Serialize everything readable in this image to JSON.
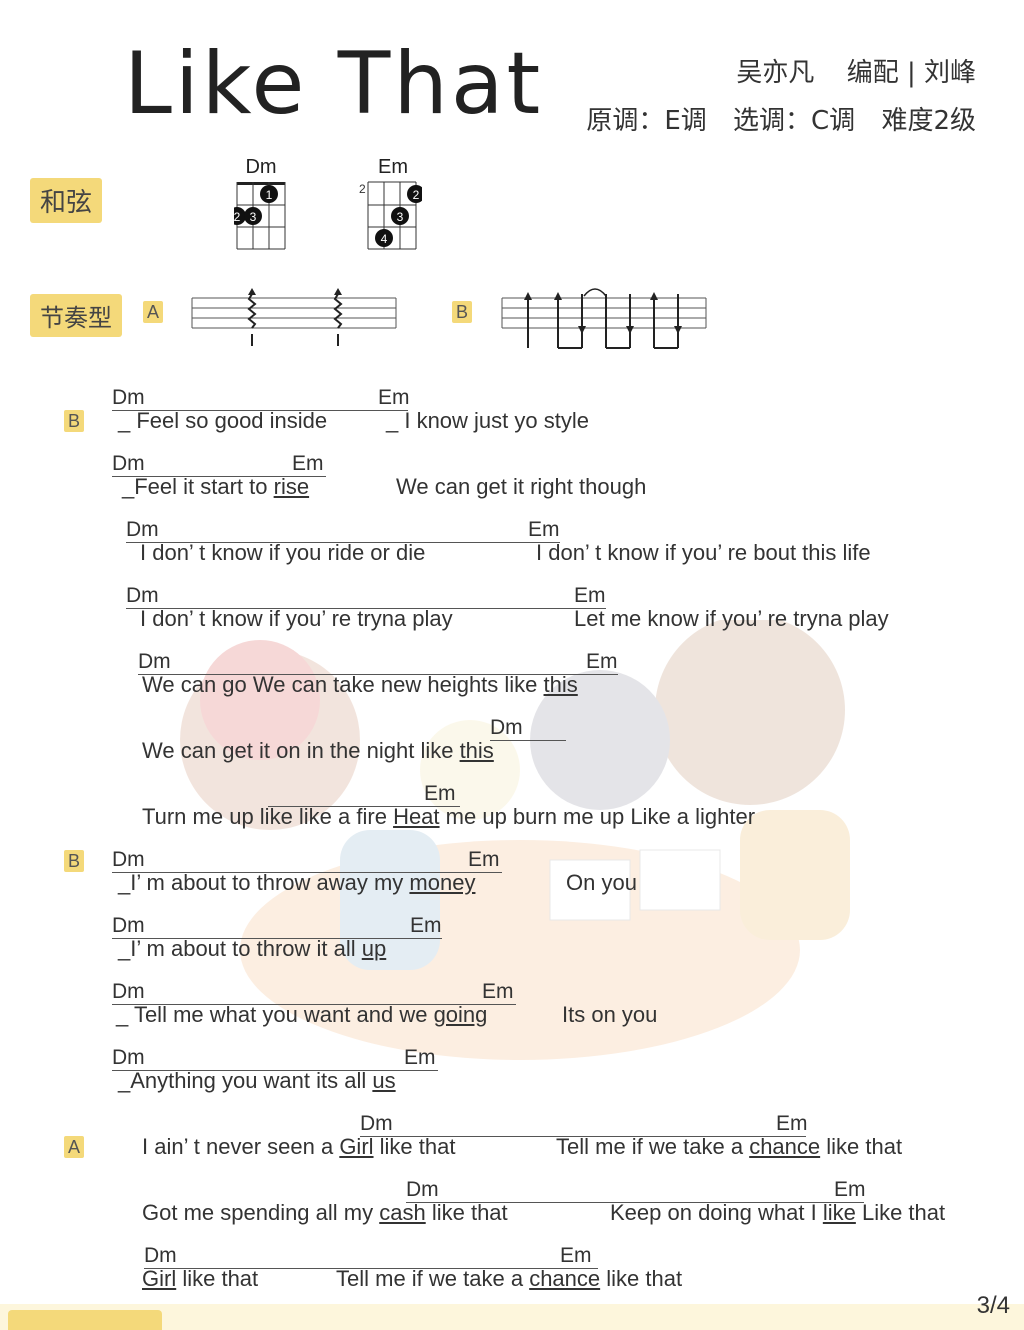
{
  "header": {
    "title": "Like That",
    "artist": "吴亦凡",
    "arranger": "编配 | 刘峰",
    "original_key": "原调：E调",
    "chosen_key": "选调：C调",
    "difficulty": "难度2级"
  },
  "sections": {
    "chords_label": "和弦",
    "rhythm_label": "节奏型",
    "rhythm_a": "A",
    "rhythm_b": "B"
  },
  "chord_diagrams": [
    {
      "name": "Dm",
      "fret_label": "",
      "fingers": [
        "1",
        "2",
        "3"
      ]
    },
    {
      "name": "Em",
      "fret_label": "2",
      "fingers": [
        "2",
        "3",
        "4"
      ]
    }
  ],
  "lyrics": [
    {
      "tag": "B",
      "chords": [
        "Dm",
        "Em"
      ],
      "text_a": "_ Feel so good inside",
      "text_b": "_ I know just yo style"
    },
    {
      "tag": "",
      "chords": [
        "Dm",
        "Em"
      ],
      "text_a": "_Feel it start to ",
      "ul_a": "rise",
      "text_b": "We can get it right though"
    },
    {
      "tag": "",
      "chords": [
        "Dm",
        "Em"
      ],
      "text_a": "I don’ t know if you ride or die",
      "text_b": "I don’ t know if you’ re bout this life"
    },
    {
      "tag": "",
      "chords": [
        "Dm",
        "Em"
      ],
      "text_a": "I don’ t know if you’ re tryna play",
      "text_b": "Let me know if you’ re tryna play"
    },
    {
      "tag": "",
      "chords": [
        "Dm",
        "Em"
      ],
      "text_a": "We can go   We can take new heights like ",
      "ul_a": "this"
    },
    {
      "tag": "",
      "chords": [
        "Dm"
      ],
      "text_a": "We can get it on in the night like ",
      "ul_a": "this"
    },
    {
      "tag": "",
      "chords": [
        "Em"
      ],
      "text_a": "Turn me up like like a fire ",
      "ul_a": "Heat",
      "text_b": " me up burn me up   Like a lighter"
    },
    {
      "tag": "B",
      "chords": [
        "Dm",
        "Em"
      ],
      "text_a": "_I’ m about to throw away my ",
      "ul_a": "money",
      "text_b": "On you"
    },
    {
      "tag": "",
      "chords": [
        "Dm",
        "Em"
      ],
      "text_a": "_I’ m about to throw it all ",
      "ul_a": "up"
    },
    {
      "tag": "",
      "chords": [
        "Dm",
        "Em"
      ],
      "text_a": "_ Tell me what you want and we ",
      "ul_a": "going",
      "text_b": "Its on you"
    },
    {
      "tag": "",
      "chords": [
        "Dm",
        "Em"
      ],
      "text_a": "_Anything you want its all ",
      "ul_a": "us"
    },
    {
      "tag": "A",
      "chords": [
        "Dm",
        "Em"
      ],
      "text_a": "I ain’ t never seen a ",
      "ul_a": "Girl",
      "text_a2": " like that",
      "text_b": "Tell me if we take a ",
      "ul_b": "chance",
      "text_b2": " like that"
    },
    {
      "tag": "",
      "chords": [
        "Dm",
        "Em"
      ],
      "text_a": "Got me spending all my ",
      "ul_a": "cash",
      "text_a2": " like that",
      "text_b": "Keep on doing what I ",
      "ul_b": "like",
      "text_b2": " Like that"
    },
    {
      "tag": "",
      "chords": [
        "Dm",
        "Em"
      ],
      "ul_a": "Girl",
      "text_a2": " like that",
      "text_b": "Tell me if we take a ",
      "ul_b": "chance",
      "text_b2": " like that"
    }
  ],
  "footer": {
    "page": "3/4"
  },
  "colors": {
    "accent": "#f4d97a",
    "text": "#333333"
  }
}
